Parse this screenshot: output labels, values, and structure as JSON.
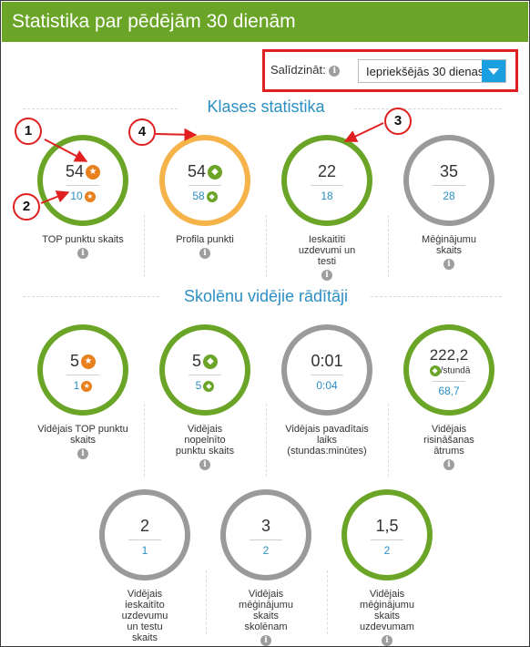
{
  "header": {
    "title": "Statistika par pēdējām 30 dienām"
  },
  "compare": {
    "label": "Salīdzināt:",
    "info_glyph": "i",
    "selected": "Iepriekšējās 30 dienas"
  },
  "class_stats": {
    "title": "Klases statistika",
    "items": [
      {
        "value": "54",
        "compare": "10",
        "label": "TOP punktu skaits",
        "icon": "star-icon",
        "ring": "green"
      },
      {
        "value": "54",
        "compare": "58",
        "label": "Profila punkti",
        "icon": "gem-icon",
        "ring": "orange"
      },
      {
        "value": "22",
        "compare": "18",
        "label": "Ieskaitīti uzdevumi un testi",
        "ring": "green"
      },
      {
        "value": "35",
        "compare": "28",
        "label": "Mēģinājumu skaits",
        "ring": "gray"
      }
    ]
  },
  "student_stats": {
    "title": "Skolēnu vidējie rādītāji",
    "items": [
      {
        "value": "5",
        "compare": "1",
        "label": "Vidējais TOP punktu skaits",
        "icon": "star-icon",
        "ring": "green"
      },
      {
        "value": "5",
        "compare": "5",
        "label": "Vidējais nopelnīto punktu skaits",
        "icon": "gem-icon",
        "ring": "green"
      },
      {
        "value": "0:01",
        "compare": "0:04",
        "label": "Vidējais pavadītais laiks (stundas:minūtes)",
        "ring": "gray"
      },
      {
        "value": "222,2",
        "unit": "/stundā",
        "compare": "68,7",
        "label": "Vidējais risināšanas ātrums",
        "icon": "gem-icon",
        "ring": "green"
      },
      {
        "value": "2",
        "compare": "1",
        "label": "Vidējais ieskaitīto uzdevumu un testu skaits",
        "ring": "gray"
      },
      {
        "value": "3",
        "compare": "2",
        "label": "Vidējais mēģinājumu skaits skolēnam",
        "ring": "gray"
      },
      {
        "value": "1,5",
        "compare": "2",
        "label": "Vidējais mēģinājumu skaits uzdevumam",
        "ring": "green"
      }
    ]
  },
  "callouts": [
    "1",
    "2",
    "3",
    "4"
  ],
  "colors": {
    "header_green": "#6aa527",
    "ring_green": "#6aa527",
    "ring_orange": "#f5b34a",
    "ring_gray": "#9a9a9a",
    "link_blue": "#2b8fc4",
    "callout_red": "#e02020"
  }
}
